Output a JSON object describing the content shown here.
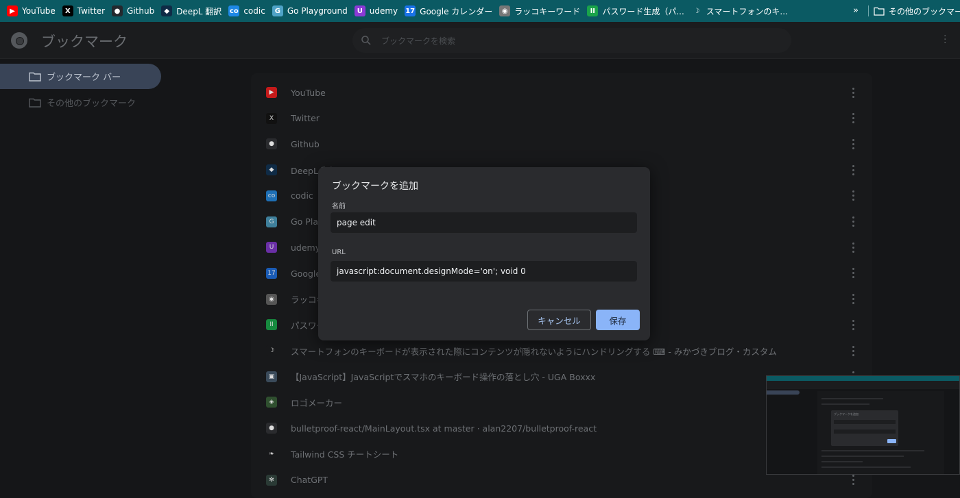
{
  "bookmarks_bar": {
    "items": [
      {
        "label": "YouTube",
        "icon": "youtube-icon",
        "color": "#ff0000",
        "glyph": "▶"
      },
      {
        "label": "Twitter",
        "icon": "x-twitter-icon",
        "color": "#000000",
        "glyph": "X"
      },
      {
        "label": "Github",
        "icon": "github-icon",
        "color": "#24292e",
        "glyph": "●"
      },
      {
        "label": "DeepL 翻訳",
        "icon": "deepl-icon",
        "color": "#0f2b46",
        "glyph": "◆"
      },
      {
        "label": "codic",
        "icon": "codic-icon",
        "color": "#1e88e5",
        "glyph": "co"
      },
      {
        "label": "Go Playground",
        "icon": "go-icon",
        "color": "#4fa3c7",
        "glyph": "G"
      },
      {
        "label": "udemy",
        "icon": "udemy-icon",
        "color": "#8b3ad6",
        "glyph": "U"
      },
      {
        "label": "Google カレンダー",
        "icon": "google-calendar-icon",
        "color": "#1a73e8",
        "glyph": "17"
      },
      {
        "label": "ラッコキーワード",
        "icon": "rakko-icon",
        "color": "#777777",
        "glyph": "◉"
      },
      {
        "label": "パスワード生成（パ...",
        "icon": "password-generator-icon",
        "color": "#1aa34a",
        "glyph": "II"
      },
      {
        "label": "スマートフォンのキ...",
        "icon": "moon-icon",
        "color": "#0b5a63",
        "glyph": "☽"
      }
    ],
    "more": "»",
    "other_bookmarks": "その他のブックマーク"
  },
  "header": {
    "title": "ブックマーク",
    "search_placeholder": "ブックマークを検索"
  },
  "sidebar": {
    "items": [
      {
        "label": "ブックマーク バー",
        "active": true
      },
      {
        "label": "その他のブックマーク",
        "active": false
      }
    ]
  },
  "list": {
    "items": [
      {
        "title": "YouTube",
        "icon": "youtube-icon",
        "color": "#c41a1a",
        "glyph": "▶"
      },
      {
        "title": "Twitter",
        "icon": "x-twitter-icon",
        "color": "#111111",
        "glyph": "X"
      },
      {
        "title": "Github",
        "icon": "github-icon",
        "color": "#2a2b2e",
        "glyph": "●"
      },
      {
        "title": "DeepL 翻訳",
        "icon": "deepl-icon",
        "color": "#0f2b46",
        "glyph": "◆"
      },
      {
        "title": "codic",
        "icon": "codic-icon",
        "color": "#1e6fb5",
        "glyph": "co"
      },
      {
        "title": "Go Playground",
        "icon": "go-icon",
        "color": "#3e7f9b",
        "glyph": "G"
      },
      {
        "title": "udemy",
        "icon": "udemy-icon",
        "color": "#6a2fa6",
        "glyph": "U"
      },
      {
        "title": "Google カレンダー",
        "icon": "google-calendar-icon",
        "color": "#1a5bb5",
        "glyph": "17"
      },
      {
        "title": "ラッコキーワード",
        "icon": "rakko-icon",
        "color": "#555555",
        "glyph": "◉"
      },
      {
        "title": "パスワード生成",
        "icon": "password-generator-icon",
        "color": "#178a3f",
        "glyph": "II"
      },
      {
        "title": "スマートフォンのキーボードが表示された際にコンテンツが隠れないようにハンドリングする ⌨ - みかづきブログ・カスタム",
        "icon": "moon-icon",
        "color": "#18191b",
        "glyph": "☽"
      },
      {
        "title": "【JavaScript】JavaScriptでスマホのキーボード操作の落とし穴 - UGA Boxxx",
        "icon": "uga-icon",
        "color": "#3a4a5a",
        "glyph": "▣"
      },
      {
        "title": "ロゴメーカー",
        "icon": "logo-maker-icon",
        "color": "#2f4f2f",
        "glyph": "◈"
      },
      {
        "title": "bulletproof-react/MainLayout.tsx at master · alan2207/bulletproof-react",
        "icon": "github-icon",
        "color": "#2a2b2e",
        "glyph": "●"
      },
      {
        "title": "Tailwind CSS チートシート",
        "icon": "tailwind-icon",
        "color": "#18191b",
        "glyph": "❧"
      },
      {
        "title": "ChatGPT",
        "icon": "chatgpt-icon",
        "color": "#2a3a35",
        "glyph": "✻"
      }
    ]
  },
  "dialog": {
    "title": "ブックマークを追加",
    "name_label": "名前",
    "name_value": "page edit",
    "url_label": "URL",
    "url_value": "javascript:document.designMode='on'; void 0",
    "cancel": "キャンセル",
    "save": "保存"
  },
  "thumbnail": {
    "dialog_title": "ブックマークを追加"
  },
  "colors": {
    "accent": "#8ab4f8",
    "bookmarks_bar_bg": "#0b5a63",
    "sidebar_active": "#394457"
  }
}
